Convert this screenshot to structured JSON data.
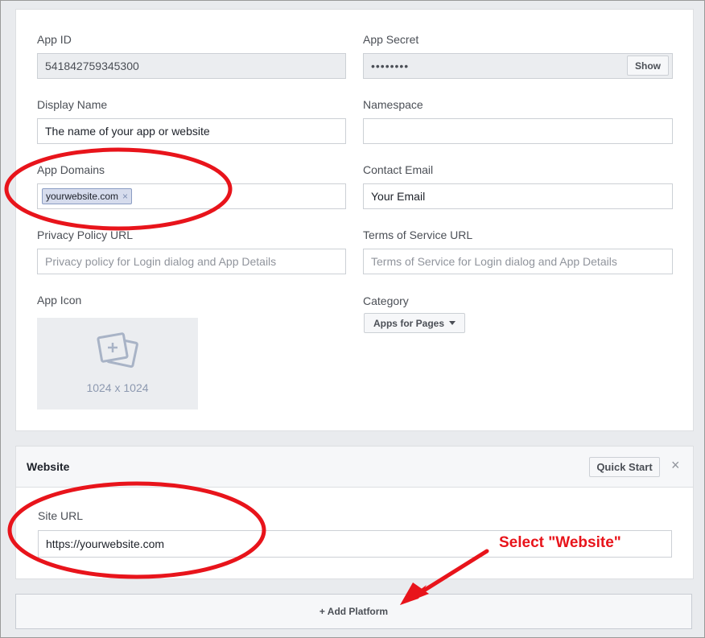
{
  "app": {
    "app_id_label": "App ID",
    "app_id_value": "541842759345300",
    "app_secret_label": "App Secret",
    "app_secret_value": "••••••••",
    "show_button": "Show",
    "display_name_label": "Display Name",
    "display_name_value": "The name of your app or website",
    "namespace_label": "Namespace",
    "namespace_value": "",
    "app_domains_label": "App Domains",
    "app_domain_tag": "yourwebsite.com",
    "contact_email_label": "Contact Email",
    "contact_email_value": "Your Email",
    "privacy_label": "Privacy Policy URL",
    "privacy_placeholder": "Privacy policy for Login dialog and App Details",
    "tos_label": "Terms of Service URL",
    "tos_placeholder": "Terms of Service for Login dialog and App Details",
    "app_icon_label": "App Icon",
    "app_icon_size": "1024 x 1024",
    "category_label": "Category",
    "category_value": "Apps for Pages"
  },
  "website": {
    "title": "Website",
    "quick_start": "Quick Start",
    "close": "×",
    "site_url_label": "Site URL",
    "site_url_value": "https://yourwebsite.com"
  },
  "add_platform": {
    "label": "+ Add Platform"
  },
  "annotation": {
    "text": "Select \"Website\"",
    "color": "#e8141b"
  },
  "icons": [
    "image-placeholder-icon",
    "caret-down-icon",
    "close-icon",
    "arrow-icon"
  ]
}
